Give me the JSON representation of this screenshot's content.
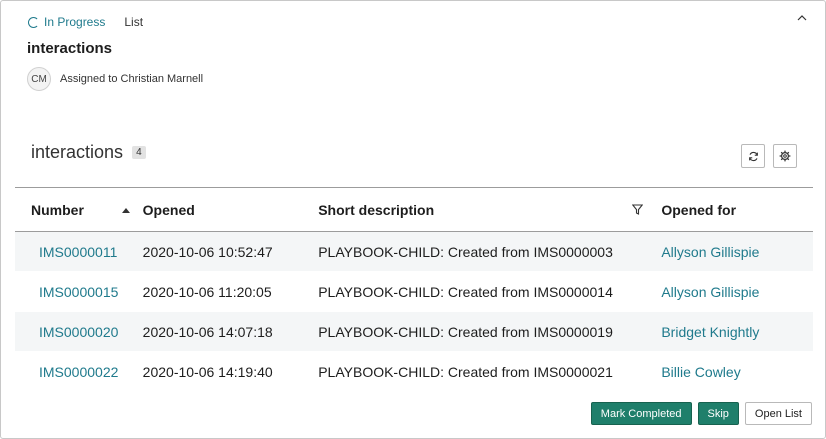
{
  "header": {
    "status": "In Progress",
    "list_tag": "List",
    "title": "interactions",
    "avatar_initials": "CM",
    "assigned_text": "Assigned to Christian Marnell"
  },
  "list": {
    "title": "interactions",
    "count": "4"
  },
  "table": {
    "columns": [
      "Number",
      "Opened",
      "Short description",
      "Opened for"
    ],
    "sort": {
      "column": "Number",
      "direction": "ascending"
    },
    "rows": [
      {
        "number": "IMS0000011",
        "opened": "2020-10-06 10:52:47",
        "description": "PLAYBOOK-CHILD: Created from IMS0000003",
        "opened_for": "Allyson Gillispie"
      },
      {
        "number": "IMS0000015",
        "opened": "2020-10-06 11:20:05",
        "description": "PLAYBOOK-CHILD: Created from IMS0000014",
        "opened_for": "Allyson Gillispie"
      },
      {
        "number": "IMS0000020",
        "opened": "2020-10-06 14:07:18",
        "description": "PLAYBOOK-CHILD: Created from IMS0000019",
        "opened_for": "Bridget Knightly"
      },
      {
        "number": "IMS0000022",
        "opened": "2020-10-06 14:19:40",
        "description": "PLAYBOOK-CHILD: Created from IMS0000021",
        "opened_for": "Billie Cowley"
      }
    ]
  },
  "footer": {
    "mark_completed": "Mark Completed",
    "skip": "Skip",
    "open_list": "Open List"
  },
  "colors": {
    "accent": "#1f7a8c",
    "primary_button": "#1f7f6b"
  },
  "icons": [
    "spinner-icon",
    "chevron-up-icon",
    "refresh-icon",
    "gear-icon",
    "sort-ascending-icon",
    "filter-icon"
  ]
}
